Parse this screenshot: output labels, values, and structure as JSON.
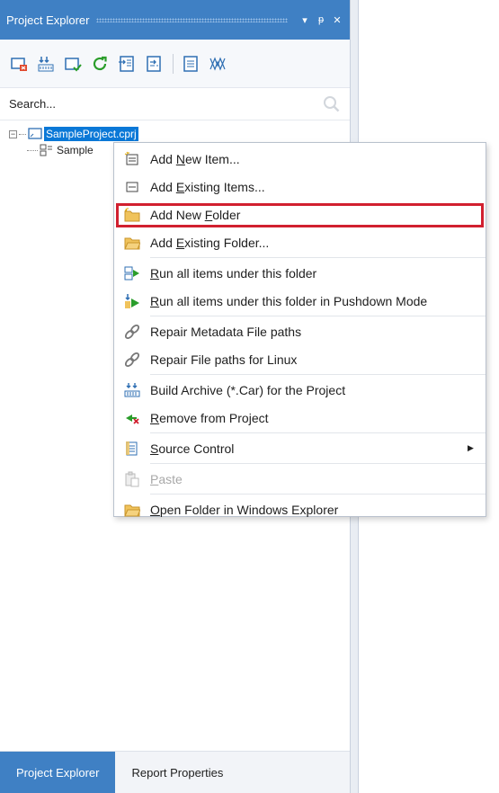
{
  "panel": {
    "title": "Project Explorer",
    "title_buttons": {
      "dropdown": "▾",
      "pin": "ᵽ",
      "close": "✕"
    }
  },
  "toolbar": {
    "tools": [
      {
        "icon": "remove-item-icon"
      },
      {
        "icon": "build-archive-icon"
      },
      {
        "icon": "check-in-icon"
      },
      {
        "icon": "refresh-icon"
      },
      {
        "icon": "import-icon"
      },
      {
        "icon": "export-icon"
      },
      {
        "icon": "properties-icon"
      },
      {
        "icon": "lineage-icon"
      }
    ]
  },
  "search": {
    "placeholder": "Search..."
  },
  "tree": {
    "root_label": "SampleProject.cprj",
    "child_label": "Sample"
  },
  "context_menu": {
    "items": [
      {
        "icon": "add-new-item-icon",
        "label_pre": "Add ",
        "label_u": "N",
        "label_post": "ew Item...",
        "disabled": false
      },
      {
        "icon": "add-existing-items-icon",
        "label_pre": "Add ",
        "label_u": "E",
        "label_post": "xisting Items...",
        "disabled": false
      },
      {
        "icon": "new-folder-icon",
        "label_pre": "Add New ",
        "label_u": "F",
        "label_post": "older",
        "disabled": false,
        "highlighted": true
      },
      {
        "icon": "existing-folder-icon",
        "label_pre": "Add ",
        "label_u": "E",
        "label_post": "xisting Folder...",
        "disabled": false
      },
      {
        "icon": "run-all-icon",
        "label_pre": "",
        "label_u": "R",
        "label_post": "un all items under this folder",
        "disabled": false
      },
      {
        "icon": "run-pushdown-icon",
        "label_pre": "",
        "label_u": "R",
        "label_post": "un all items under this folder in Pushdown Mode",
        "disabled": false
      },
      {
        "icon": "repair-link-icon",
        "label_pre": "Repair Metadata File paths",
        "label_u": "",
        "label_post": "",
        "disabled": false
      },
      {
        "icon": "repair-linux-icon",
        "label_pre": "Repair File paths for Linux",
        "label_u": "",
        "label_post": "",
        "disabled": false
      },
      {
        "icon": "build-archive-icon",
        "label_pre": "Build Archive (*.Car) for the Project",
        "label_u": "",
        "label_post": "",
        "disabled": false
      },
      {
        "icon": "remove-project-icon",
        "label_pre": "",
        "label_u": "R",
        "label_post": "emove from Project",
        "disabled": false
      },
      {
        "icon": "source-control-icon",
        "label_pre": "",
        "label_u": "S",
        "label_post": "ource Control",
        "disabled": false,
        "submenu": "▶"
      },
      {
        "icon": "paste-icon",
        "label_pre": "",
        "label_u": "P",
        "label_post": "aste",
        "disabled": true
      },
      {
        "icon": "open-folder-icon",
        "label_pre": "",
        "label_u": "O",
        "label_post": "pen Folder in Windows Explorer",
        "disabled": false
      }
    ]
  },
  "bottom_tabs": [
    {
      "label": "Project Explorer",
      "active": true
    },
    {
      "label": "Report Properties",
      "active": false
    }
  ],
  "colors": {
    "accent": "#3f80c4",
    "selection": "#0a78d7",
    "highlight_box": "#d1202f"
  }
}
